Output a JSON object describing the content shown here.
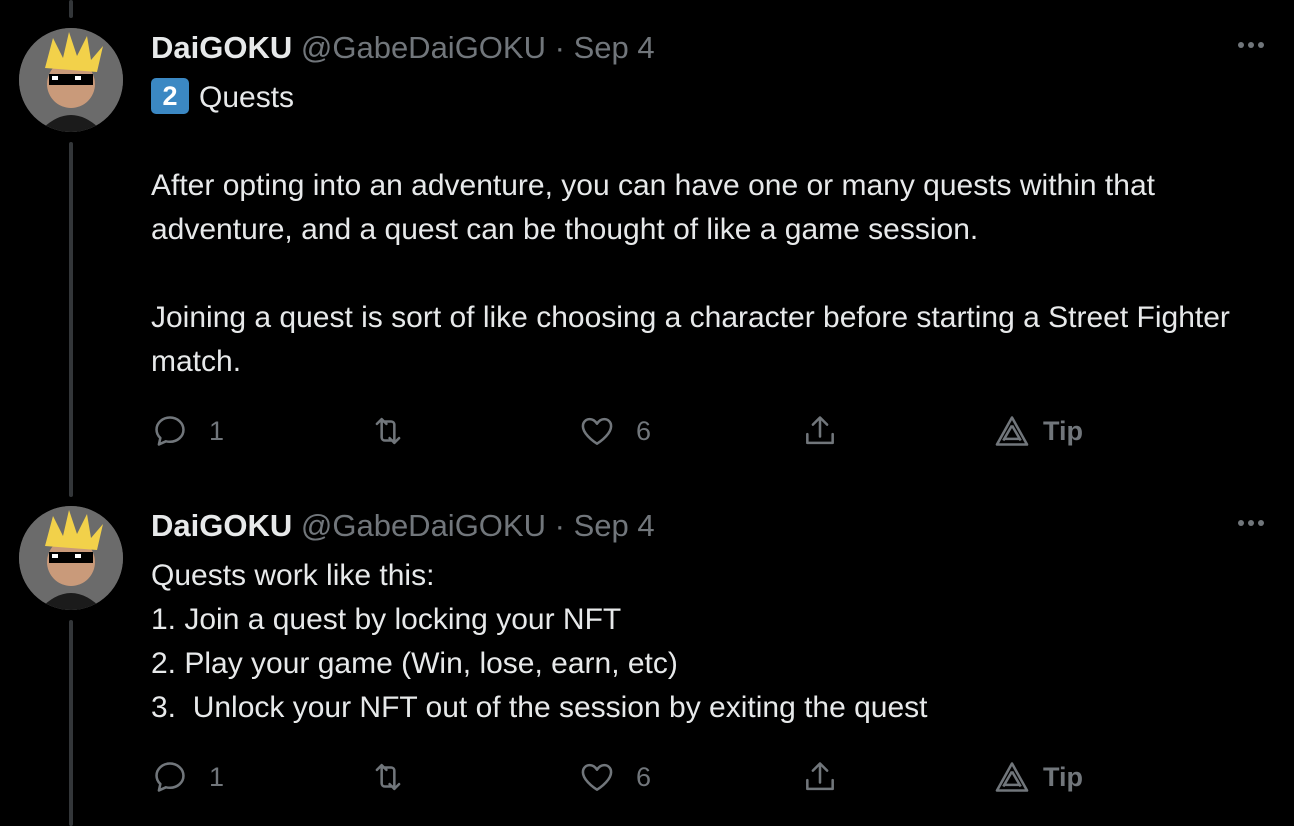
{
  "tweets": [
    {
      "name": "DaiGOKU",
      "handle": "@GabeDaiGOKU",
      "separator": "·",
      "date": "Sep 4",
      "keycap": "2",
      "title_line": "Quests",
      "body": "After opting into an adventure, you can have one or many quests within that adventure, and a quest can be thought of like a game session.\n\nJoining a quest is sort of like choosing a character before starting a Street Fighter match.",
      "reply_count": "1",
      "retweet_count": "",
      "like_count": "6",
      "tip_label": "Tip"
    },
    {
      "name": "DaiGOKU",
      "handle": "@GabeDaiGOKU",
      "separator": "·",
      "date": "Sep 4",
      "body": "Quests work like this:\n1. Join a quest by locking your NFT\n2. Play your game (Win, lose, earn, etc)\n3.  Unlock your NFT out of the session by exiting the quest",
      "reply_count": "1",
      "retweet_count": "",
      "like_count": "6",
      "tip_label": "Tip"
    }
  ],
  "icons": {
    "more": "more-horizontal-icon",
    "reply": "reply-icon",
    "retweet": "retweet-icon",
    "like": "heart-icon",
    "share": "share-icon",
    "tip": "tip-icon"
  }
}
